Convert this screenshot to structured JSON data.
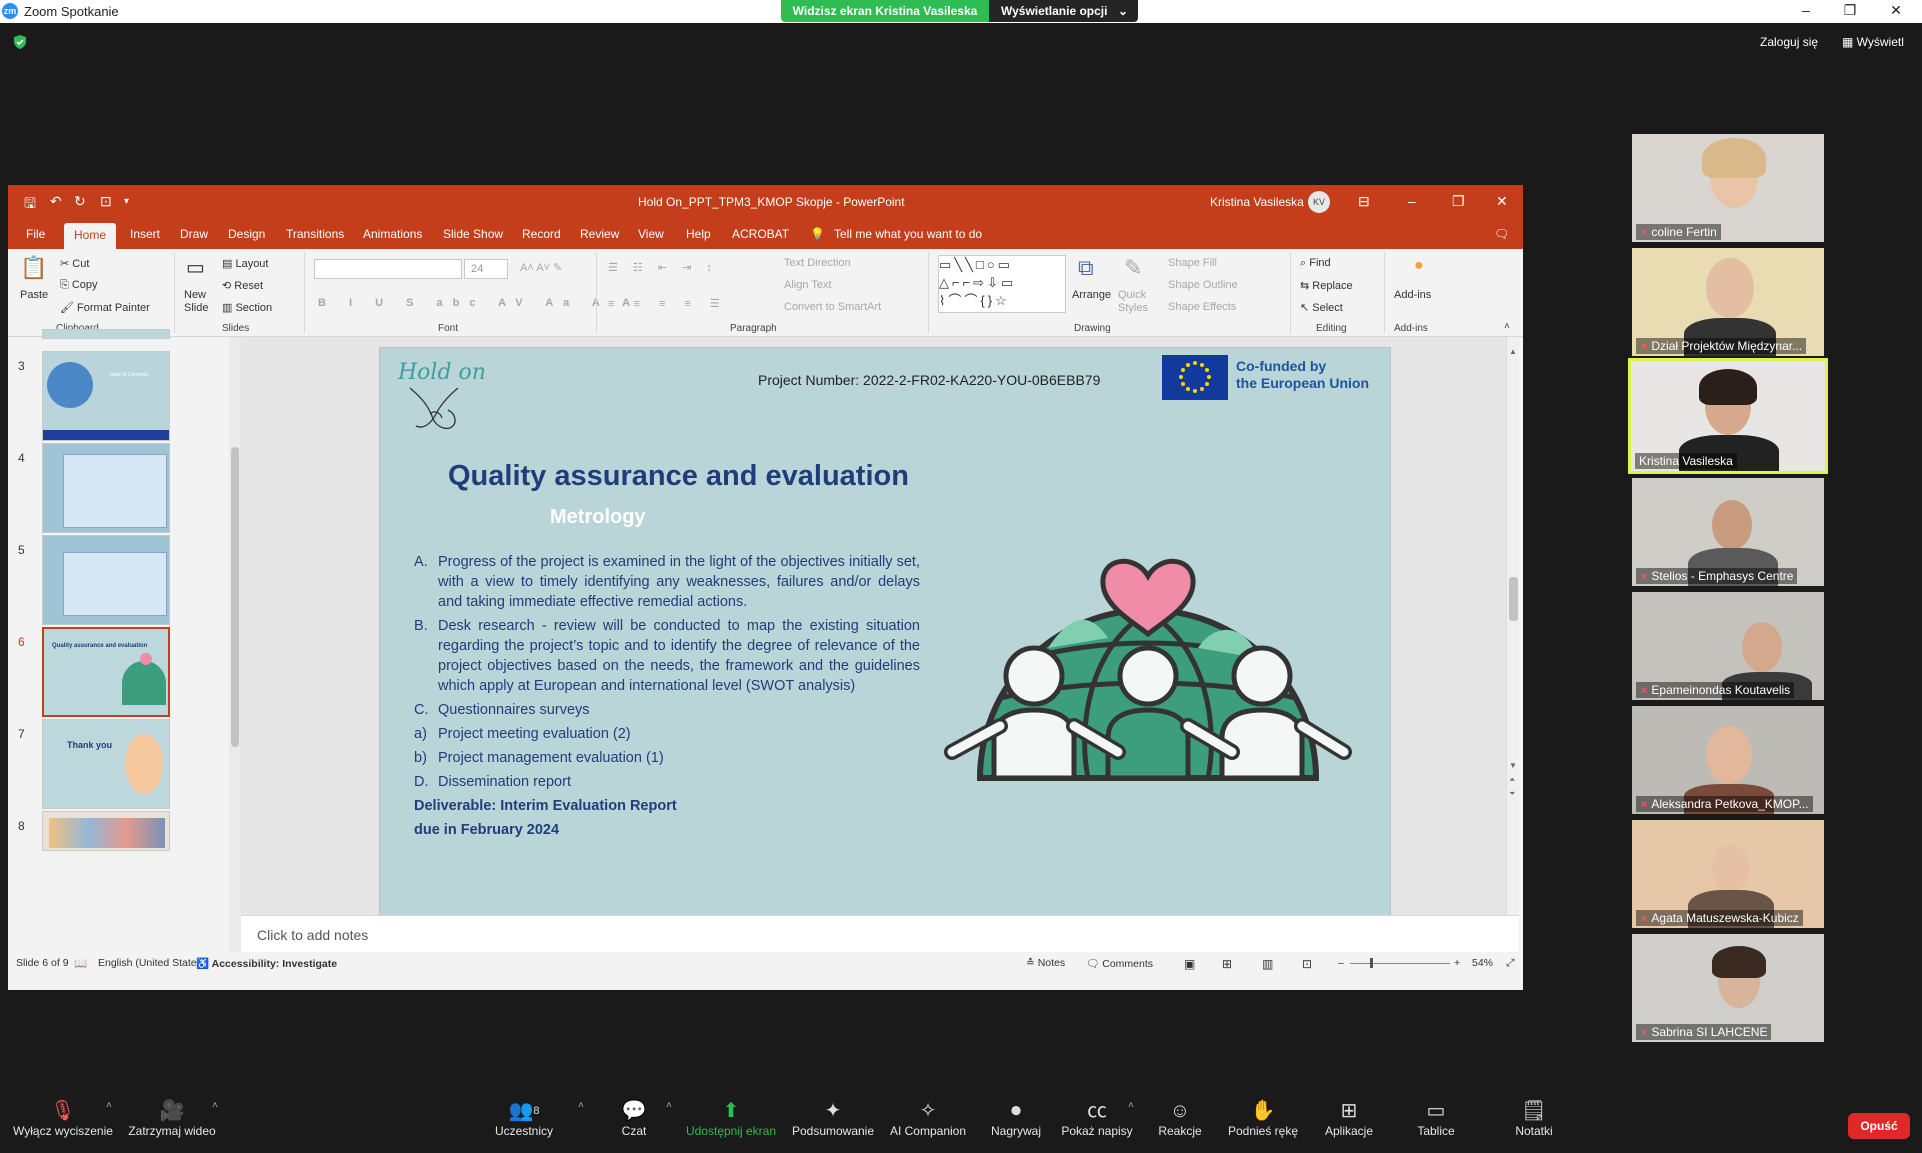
{
  "zoom": {
    "window_title": "Zoom Spotkanie",
    "share_banner_text": "Widzisz ekran Kristina Vasileska",
    "view_options": "Wyświetlanie opcji",
    "login": "Zaloguj się",
    "view": "Wyświetl",
    "participants_count": "8",
    "toolbar": {
      "mute": "Wyłącz wyciszenie",
      "video": "Zatrzymaj wideo",
      "participants": "Uczestnicy",
      "chat": "Czat",
      "share": "Udostępnij ekran",
      "summary": "Podsumowanie",
      "ai": "AI Companion",
      "record": "Nagrywaj",
      "captions": "Pokaż napisy",
      "reactions": "Reakcje",
      "raise_hand": "Podnieś rękę",
      "apps": "Aplikacje",
      "whiteboards": "Tablice",
      "notes": "Notatki",
      "leave": "Opuść"
    }
  },
  "participants": [
    {
      "name": "coline Fertin"
    },
    {
      "name": "Dział Projektów Międzynar..."
    },
    {
      "name": "Kristina Vasileska"
    },
    {
      "name": "Stelios - Emphasys Centre"
    },
    {
      "name": "Epameinondas Koutavelis"
    },
    {
      "name": "Aleksandra Petkova_KMOP..."
    },
    {
      "name": "Agata Matuszewska-Kubicz"
    },
    {
      "name": "Sabrina SI LAHCENE"
    }
  ],
  "ppt": {
    "title": "Hold On_PPT_TPM3_KMOP Skopje  -  PowerPoint",
    "user": "Kristina Vasileska",
    "user_initials": "KV",
    "tabs": [
      "File",
      "Home",
      "Insert",
      "Draw",
      "Design",
      "Transitions",
      "Animations",
      "Slide Show",
      "Record",
      "Review",
      "View",
      "Help",
      "ACROBAT"
    ],
    "tell_me": "Tell me what you want to do",
    "ribbon": {
      "paste": "Paste",
      "cut": "Cut",
      "copy": "Copy",
      "format_painter": "Format Painter",
      "clipboard": "Clipboard",
      "new_slide": "New Slide",
      "layout": "Layout",
      "reset": "Reset",
      "section": "Section",
      "slides": "Slides",
      "font_size": "24",
      "font": "Font",
      "text_direction": "Text Direction",
      "align_text": "Align Text",
      "convert_smartart": "Convert to SmartArt",
      "paragraph": "Paragraph",
      "arrange": "Arrange",
      "quick_styles": "Quick Styles",
      "shape_fill": "Shape Fill",
      "shape_outline": "Shape Outline",
      "shape_effects": "Shape Effects",
      "drawing": "Drawing",
      "find": "Find",
      "replace": "Replace",
      "select": "Select",
      "editing": "Editing",
      "addins": "Add-ins",
      "addins_group": "Add-ins"
    },
    "thumbnails": [
      {
        "num": "3",
        "title": "Table of Contents"
      },
      {
        "num": "4",
        "title": ""
      },
      {
        "num": "5",
        "title": ""
      },
      {
        "num": "6",
        "title": "Quality assurance and evaluation"
      },
      {
        "num": "7",
        "title": "Thank you"
      },
      {
        "num": "8",
        "title": ""
      }
    ],
    "slide": {
      "logo_text": "Hold on",
      "project_number": "Project Number: 2022-2-FR02-KA220-YOU-0B6EBB79",
      "cofunded_line1": "Co-funded by",
      "cofunded_line2": "the European Union",
      "title": "Quality assurance and evaluation",
      "subtitle": "Metrology",
      "items": [
        {
          "key": "A.",
          "text": "Progress of the project is examined in the light of the objectives initially set, with a view to timely identifying any weaknesses, failures and/or delays and taking immediate effective remedial actions."
        },
        {
          "key": "B.",
          "text": "Desk research -  review will be conducted to map the existing situation regarding the project’s topic and to identify the degree of relevance of the project objectives based on the needs, the framework and the guidelines which apply at European and international level (SWOT analysis)"
        },
        {
          "key": "C.",
          "text": "Questionnaires surveys"
        },
        {
          "key": "a)",
          "text": "Project meeting evaluation (2)"
        },
        {
          "key": "b)",
          "text": "Project management evaluation (1)"
        },
        {
          "key": "D.",
          "text": "Dissemination report"
        }
      ],
      "deliverable_line1": "Deliverable: Interim Evaluation Report",
      "deliverable_line2": "due in February 2024"
    },
    "notes_placeholder": "Click to add notes",
    "status": {
      "slide": "Slide 6 of 9",
      "language": "English (United States)",
      "accessibility": "Accessibility: Investigate",
      "notes": "Notes",
      "comments": "Comments",
      "zoom": "54%"
    }
  },
  "colors": {
    "ppt_accent": "#c43e1c",
    "zoom_green": "#2fbc52",
    "slide_bg": "#bad5d7",
    "title_blue": "#1f3d7a",
    "globe_green": "#3d9e7e",
    "heart_pink": "#f08ba8"
  }
}
